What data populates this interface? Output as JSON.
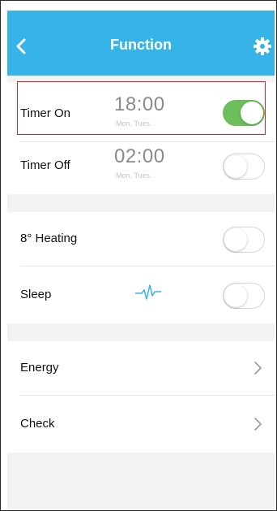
{
  "header": {
    "title": "Function",
    "background_color": "#36b4e8",
    "back_icon": "chevron-left-icon",
    "settings_icon": "gear-icon"
  },
  "timers": {
    "timer_on": {
      "label": "Timer On",
      "time": "18:00",
      "days": "Mon. Tues.",
      "enabled": true
    },
    "timer_off": {
      "label": "Timer Off",
      "time": "02:00",
      "days": "Mon. Tues.",
      "enabled": false
    }
  },
  "modes": {
    "heating": {
      "label": "8° Heating",
      "enabled": false
    },
    "sleep": {
      "label": "Sleep",
      "icon": "sleep-curve-icon",
      "enabled": false
    }
  },
  "links": {
    "energy": {
      "label": "Energy",
      "icon": "chevron-right-icon"
    },
    "check": {
      "label": "Check",
      "icon": "chevron-right-icon"
    }
  },
  "colors": {
    "toggle_on": "#6cbf5a",
    "toggle_off_border": "#d6d6d6",
    "highlight_border": "#e0202a",
    "sleep_icon": "#36b4e8"
  }
}
